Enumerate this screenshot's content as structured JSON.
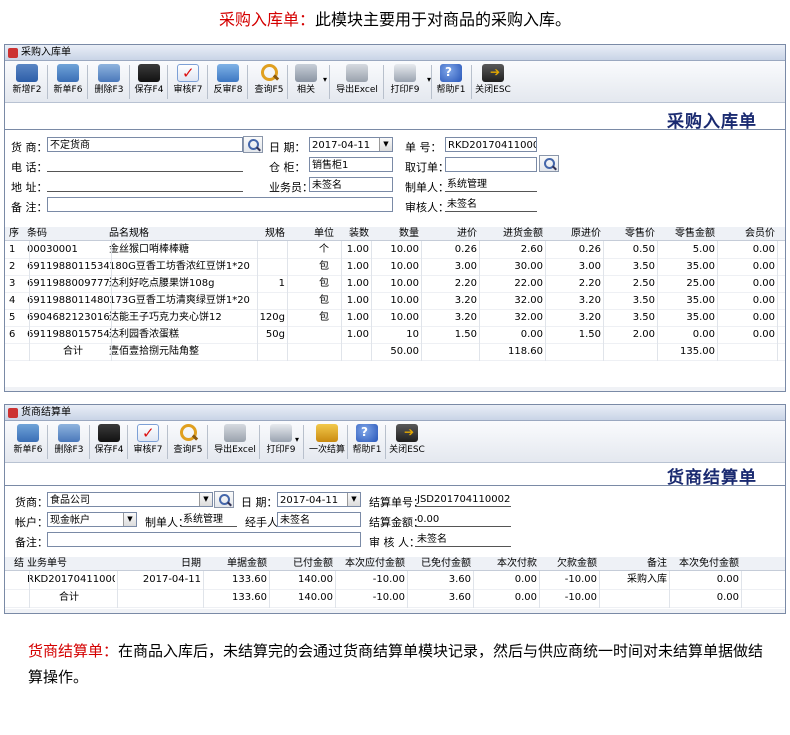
{
  "heading": {
    "title": "采购入库单：",
    "desc": "此模块主要用于对商品的采购入库。"
  },
  "purchase": {
    "window_title": "采购入库单",
    "toolbar": [
      {
        "label": "新增F2",
        "icon": "new-doc-icon",
        "cls": "ic-new"
      },
      {
        "label": "新单F6",
        "icon": "new-bill-icon",
        "cls": "ic-add"
      },
      {
        "label": "删除F3",
        "icon": "delete-icon",
        "cls": "ic-del"
      },
      {
        "label": "保存F4",
        "icon": "save-icon",
        "cls": "ic-save"
      },
      {
        "label": "审核F7",
        "icon": "audit-check-icon",
        "cls": "ic-audit"
      },
      {
        "label": "反审F8",
        "icon": "undo-icon",
        "cls": "ic-undo"
      },
      {
        "label": "查询F5",
        "icon": "search-icon",
        "cls": "ic-query"
      },
      {
        "label": "相关",
        "icon": "related-icon",
        "cls": "ic-rel"
      },
      {
        "label": "导出Excel",
        "icon": "export-icon",
        "cls": "ic-export"
      },
      {
        "label": "打印F9",
        "icon": "print-icon",
        "cls": "ic-print"
      },
      {
        "label": "帮助F1",
        "icon": "help-icon",
        "cls": "ic-help"
      },
      {
        "label": "关闭ESC",
        "icon": "close-door-icon",
        "cls": "ic-close"
      }
    ],
    "form_title": "采购入库单",
    "fields": {
      "supplier_label": "货 商：",
      "supplier_value": "不定货商",
      "date_label": "日  期：",
      "date_value": "2017-04-11",
      "billno_label": "单  号：",
      "billno_value": "RKD201704110001",
      "phone_label": "电  话：",
      "phone_value": "",
      "warehouse_label": "仓  柜：",
      "warehouse_value": "销售柜1",
      "order_label": "取订单：",
      "order_value": "",
      "address_label": "地  址：",
      "address_value": "",
      "clerk_label": "业务员：",
      "clerk_value": "未签名",
      "maker_label": "制单人：",
      "maker_value": "系统管理",
      "remark_label": "备  注：",
      "remark_value": "",
      "auditor_label": "审核人：",
      "auditor_value": "未签名"
    },
    "columns": [
      "序",
      "条码",
      "品名规格",
      "规格",
      "单位",
      "装数",
      "数量",
      "进价",
      "进货金额",
      "原进价",
      "零售价",
      "零售金额",
      "会员价"
    ],
    "rows": [
      [
        "1",
        "00030001",
        "金丝猴口哨棒棒糖",
        "",
        "个",
        "1.00",
        "10.00",
        "0.26",
        "2.60",
        "0.26",
        "0.50",
        "5.00",
        "0.00"
      ],
      [
        "2",
        "6911988011534",
        "180G豆香工坊香浓红豆饼1*20",
        "",
        "包",
        "1.00",
        "10.00",
        "3.00",
        "30.00",
        "3.00",
        "3.50",
        "35.00",
        "0.00"
      ],
      [
        "3",
        "6911988009777",
        "达利好吃点腰果饼108g",
        "1",
        "包",
        "1.00",
        "10.00",
        "2.20",
        "22.00",
        "2.20",
        "2.50",
        "25.00",
        "0.00"
      ],
      [
        "4",
        "6911988011480",
        "173G豆香工坊清爽绿豆饼1*20",
        "",
        "包",
        "1.00",
        "10.00",
        "3.20",
        "32.00",
        "3.20",
        "3.50",
        "35.00",
        "0.00"
      ],
      [
        "5",
        "6904682123016",
        "达能王子巧克力夹心饼12",
        "120g",
        "包",
        "1.00",
        "10.00",
        "3.20",
        "32.00",
        "3.20",
        "3.50",
        "35.00",
        "0.00"
      ],
      [
        "6",
        "6911988015754",
        "达利园香浓蛋糕",
        "50g",
        "",
        "1.00",
        "10",
        "1.50",
        "0.00",
        "1.50",
        "2.00",
        "0.00",
        "0.00"
      ]
    ],
    "total": {
      "label": "合计",
      "amount_words": "壹佰壹拾捌元陆角整",
      "qty": "50.00",
      "amount": "118.60",
      "retail_amount": "135.00"
    }
  },
  "settle": {
    "window_title": "货商结算单",
    "toolbar": [
      {
        "label": "新单F6",
        "icon": "new-bill-icon",
        "cls": "ic-add"
      },
      {
        "label": "删除F3",
        "icon": "delete-icon",
        "cls": "ic-del"
      },
      {
        "label": "保存F4",
        "icon": "save-icon",
        "cls": "ic-save"
      },
      {
        "label": "审核F7",
        "icon": "audit-check-icon",
        "cls": "ic-audit"
      },
      {
        "label": "查询F5",
        "icon": "search-icon",
        "cls": "ic-query"
      },
      {
        "label": "导出Excel",
        "icon": "export-icon",
        "cls": "ic-export"
      },
      {
        "label": "打印F9",
        "icon": "print-icon",
        "cls": "ic-print"
      },
      {
        "label": "一次结算",
        "icon": "settle-icon",
        "cls": "ic-settle"
      },
      {
        "label": "帮助F1",
        "icon": "help-icon",
        "cls": "ic-help"
      },
      {
        "label": "关闭ESC",
        "icon": "close-door-icon",
        "cls": "ic-close"
      }
    ],
    "form_title": "货商结算单",
    "fields": {
      "supplier_label": "货商：",
      "supplier_value": "食品公司",
      "date_label": "日  期：",
      "date_value": "2017-04-11",
      "billno_label": "结算单号：",
      "billno_value": "JSD201704110002",
      "account_label": "帐户：",
      "account_value": "现金帐户",
      "maker_label": "制单人：",
      "maker_value": "系统管理",
      "handler_label": "经手人：",
      "handler_value": "未签名",
      "amount_label": "结算金额：",
      "amount_value": "0.00",
      "remark_label": "备注：",
      "remark_value": "",
      "auditor_label": "审 核 人：",
      "auditor_value": "未签名"
    },
    "columns": [
      "结",
      "业务单号",
      "日期",
      "单据金额",
      "已付金额",
      "本次应付金额",
      "已免付金额",
      "本次付款",
      "欠款金额",
      "备注",
      "本次免付金额"
    ],
    "rows": [
      [
        "",
        "RKD201704110001",
        "2017-04-11",
        "133.60",
        "140.00",
        "-10.00",
        "3.60",
        "0.00",
        "-10.00",
        "采购入库",
        "0.00"
      ]
    ],
    "total": {
      "label": "合计",
      "bill_amount": "133.60",
      "paid": "140.00",
      "payable": "-10.00",
      "waived": "3.60",
      "pay": "0.00",
      "debt": "-10.00",
      "waive_now": "0.00"
    }
  },
  "note": {
    "title": "货商结算单：",
    "desc": "在商品入库后，未结算完的会通过货商结算单模块记录，然后与供应商统一时间对未结算单据做结算操作。"
  }
}
